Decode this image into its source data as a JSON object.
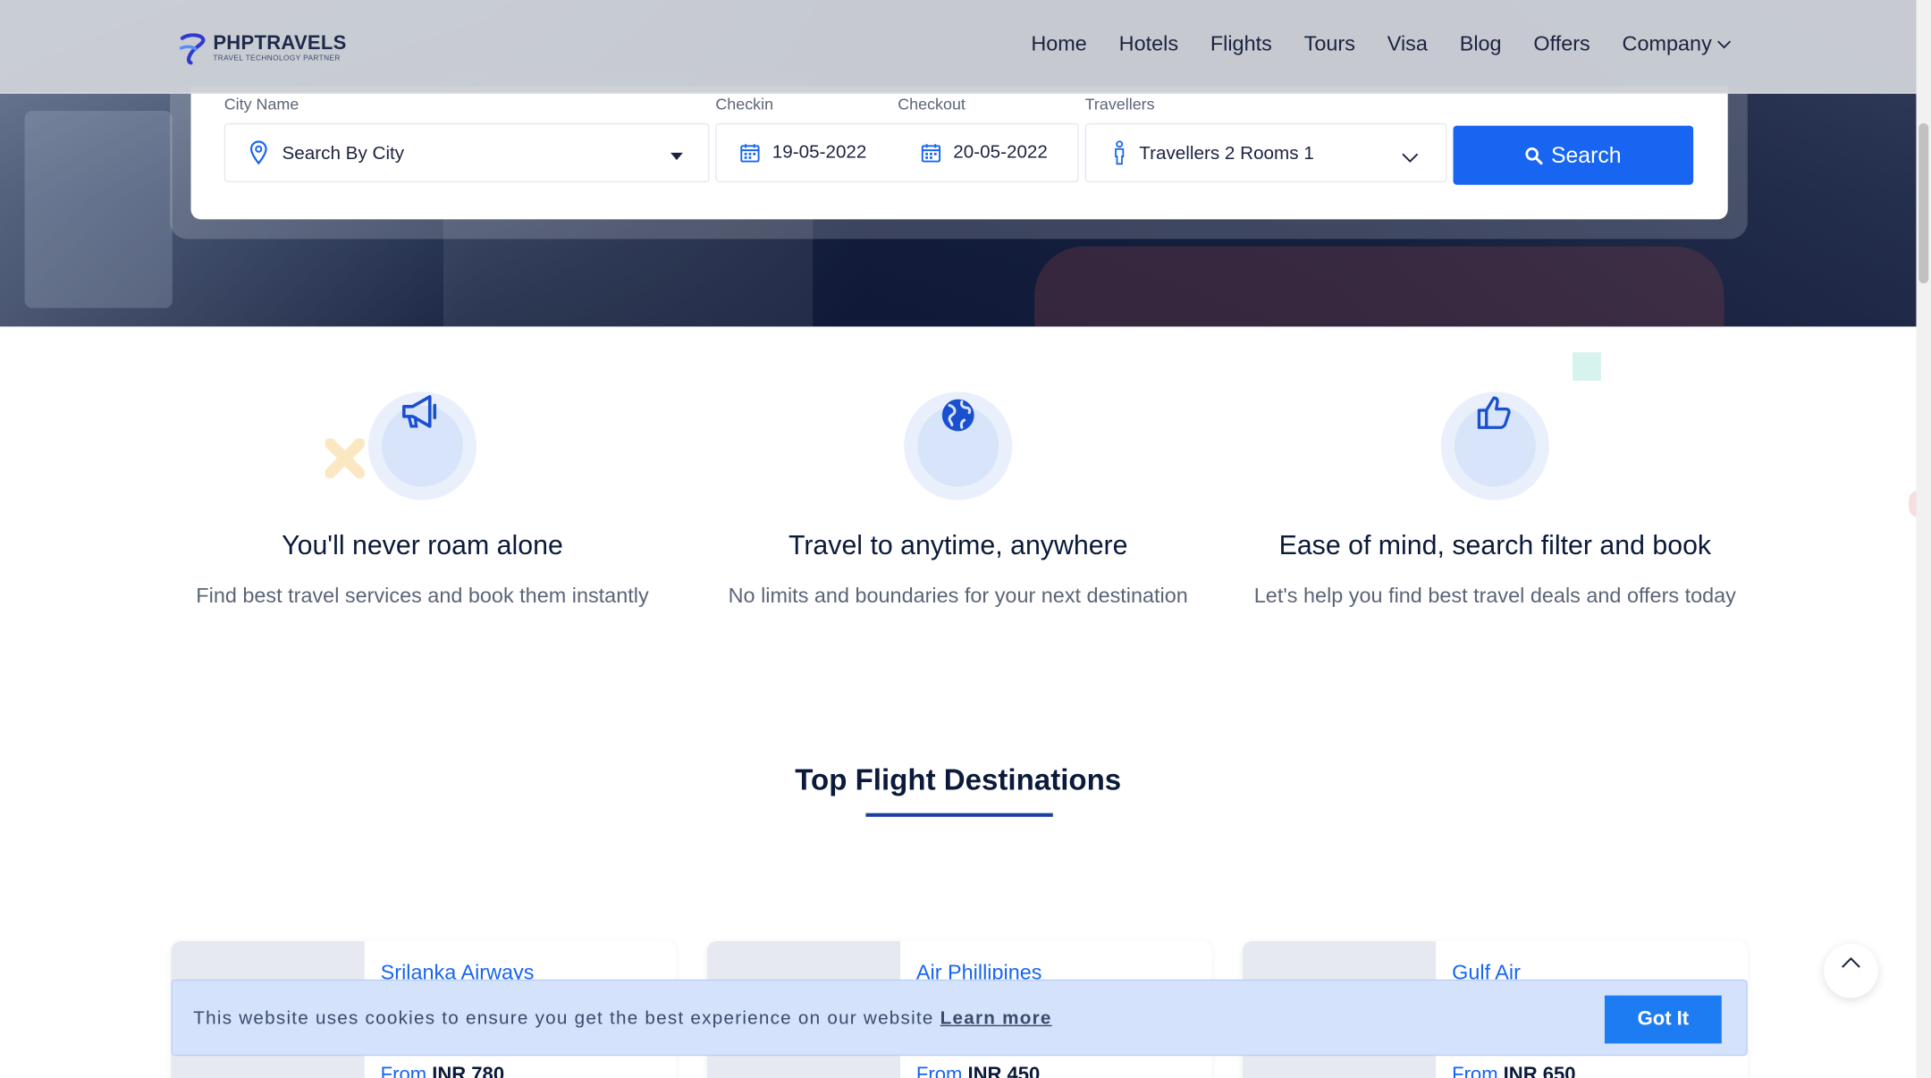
{
  "brand": {
    "title": "PHPTRAVELS",
    "subtitle": "TRAVEL TECHNOLOGY PARTNER",
    "primary_color": "#1765f1",
    "dark_text_color": "#0b1a3a"
  },
  "nav": {
    "items": [
      "Home",
      "Hotels",
      "Flights",
      "Tours",
      "Visa",
      "Blog",
      "Offers"
    ],
    "company_label": "Company"
  },
  "search": {
    "city_label": "City Name",
    "city_placeholder": "Search By City",
    "checkin_label": "Checkin",
    "checkin_value": "19-05-2022",
    "checkout_label": "Checkout",
    "checkout_value": "20-05-2022",
    "travellers_label": "Travellers",
    "travellers_value": "Travellers 2 Rooms 1",
    "button_label": "Search"
  },
  "features": [
    {
      "icon": "megaphone-icon",
      "title": "You'll never roam alone",
      "text": "Find best travel services and book them instantly"
    },
    {
      "icon": "globe-icon",
      "title": "Travel to anytime, anywhere",
      "text": "No limits and boundaries for your next destination"
    },
    {
      "icon": "thumbs-up-icon",
      "title": "Ease of mind, search filter and book",
      "text": "Let's help you find best travel deals and offers today"
    }
  ],
  "destinations": {
    "title": "Top Flight Destinations",
    "cards": [
      {
        "airline": "Srilanka Airways",
        "from": "From",
        "price": "INR 780"
      },
      {
        "airline": "Air Phillipines",
        "from": "From",
        "price": "INR 450"
      },
      {
        "airline": "Gulf Air",
        "from": "From",
        "price": "INR 650"
      }
    ]
  },
  "cookie": {
    "message": "This website uses cookies to ensure you get the best experience on our website",
    "link_label": "Learn more",
    "button_label": "Got It"
  }
}
